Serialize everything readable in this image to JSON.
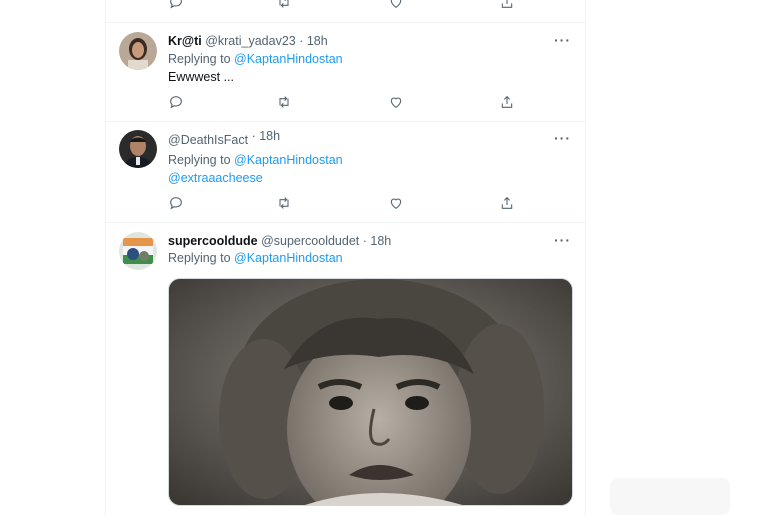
{
  "tweets": [
    {
      "name": "Kr@ti",
      "handle": "@krati_yadav23",
      "time": "· 18h",
      "replying_prefix": "Replying to",
      "replying_to": "@KaptanHindostan",
      "text": "Ewwwest ...",
      "more_label": "···"
    },
    {
      "name": "",
      "handle": "@DeathIsFact",
      "time": "· 18h",
      "replying_prefix": "Replying to",
      "replying_to": "@KaptanHindostan",
      "text": "@extraaacheese",
      "more_label": "···"
    },
    {
      "name": "supercooldude",
      "handle": "@supercooldudet",
      "time": "· 18h",
      "replying_prefix": "Replying to",
      "replying_to": "@KaptanHindostan",
      "more_label": "···"
    }
  ],
  "icons": [
    "reply-icon",
    "retweet-icon",
    "like-icon",
    "share-icon"
  ],
  "colors": {
    "link": "#1d9bf0",
    "muted": "#536471",
    "text": "#0f1419",
    "border": "#eff3f4"
  }
}
